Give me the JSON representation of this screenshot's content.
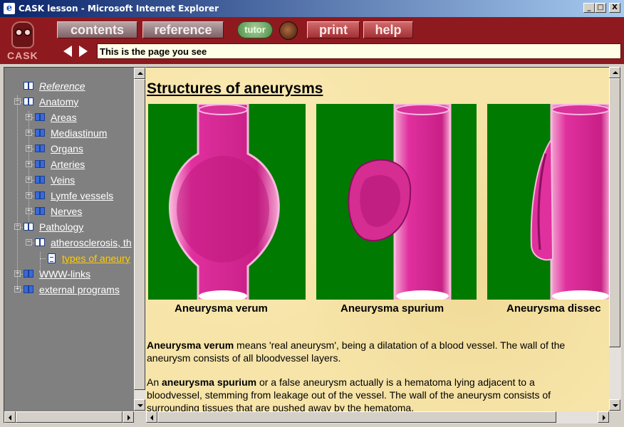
{
  "window": {
    "title": "CASK lesson - Microsoft Internet Explorer",
    "controls": {
      "minimize": "_",
      "maximize": "□",
      "close": "X"
    }
  },
  "toolbar": {
    "logo_text": "CASK",
    "buttons": {
      "contents": "contents",
      "reference": "reference",
      "tutor": "tutor",
      "print": "print",
      "help": "help"
    },
    "status_text": "This is the page you see"
  },
  "tree": [
    {
      "label": "Reference",
      "level": 0,
      "icon": "open-book-icon",
      "expander": "none",
      "italic": true
    },
    {
      "label": "Anatomy",
      "level": 0,
      "icon": "open-book-icon",
      "expander": "minus"
    },
    {
      "label": "Areas",
      "level": 1,
      "icon": "closed-book-icon",
      "expander": "plus"
    },
    {
      "label": "Mediastinum",
      "level": 1,
      "icon": "closed-book-icon",
      "expander": "plus"
    },
    {
      "label": "Organs",
      "level": 1,
      "icon": "closed-book-icon",
      "expander": "plus"
    },
    {
      "label": "Arteries",
      "level": 1,
      "icon": "closed-book-icon",
      "expander": "plus"
    },
    {
      "label": "Veins",
      "level": 1,
      "icon": "closed-book-icon",
      "expander": "plus"
    },
    {
      "label": "Lymfe vessels",
      "level": 1,
      "icon": "closed-book-icon",
      "expander": "plus"
    },
    {
      "label": "Nerves",
      "level": 1,
      "icon": "closed-book-icon",
      "expander": "plus"
    },
    {
      "label": "Pathology",
      "level": 0,
      "icon": "open-book-icon",
      "expander": "minus"
    },
    {
      "label": "atherosclerosis, th",
      "level": 1,
      "icon": "open-book-icon",
      "expander": "minus"
    },
    {
      "label": "types of aneury",
      "level": 2,
      "icon": "document-icon",
      "expander": "none",
      "active": true
    },
    {
      "label": "WWW-links",
      "level": 0,
      "icon": "closed-book-icon",
      "expander": "plus"
    },
    {
      "label": "external programs",
      "level": 0,
      "icon": "closed-book-icon",
      "expander": "plus"
    }
  ],
  "page": {
    "heading": "Structures of aneurysms",
    "images": [
      {
        "caption": "Aneurysma verum"
      },
      {
        "caption": "Aneurysma spurium"
      },
      {
        "caption": "Aneurysma dissec"
      }
    ],
    "para1": {
      "term": "Aneurysma verum",
      "text": " means 'real aneurysm', being a dilatation of a blood vessel. The wall of the aneurysm consists of all bloodvessel layers."
    },
    "para2": {
      "prefix": "An ",
      "term": "aneurysma spurium",
      "text": " or a false aneurysm actually is a hematoma lying adjacent to a bloodvessel, stemming from leakage out of the vessel. The wall of the aneurysm consists of surrounding tissues that are pushed away by the hematoma."
    }
  },
  "colors": {
    "toolbar_bg": "#8e1a1f",
    "content_bg": "#f6e4a8",
    "image_bg": "#007a00",
    "vessel": "#e0309e",
    "tree_bg": "#808080",
    "active_link": "#ffcc00"
  }
}
